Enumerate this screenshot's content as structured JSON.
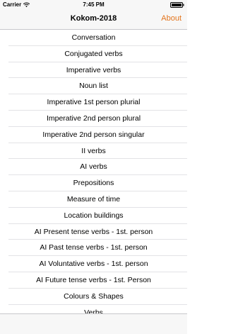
{
  "status_bar": {
    "carrier": "Carrier",
    "time": "7:45 PM"
  },
  "nav": {
    "title": "Kokom-2018",
    "about_label": "About"
  },
  "list": {
    "items": [
      "Conversation",
      "Conjugated verbs",
      "Imperative verbs",
      "Noun list",
      "Imperative 1st person plurial",
      "Imperative 2nd person plural",
      "Imperative 2nd person singular",
      "II verbs",
      "AI verbs",
      "Prepositions",
      "Measure of time",
      "Location buildings",
      "AI Present tense verbs - 1st. person",
      "AI Past tense verbs - 1st. person",
      "AI Voluntative verbs - 1st. person",
      "AI Future tense verbs - 1st. Person",
      "Colours & Shapes",
      "Verbs"
    ]
  },
  "colors": {
    "accent": "#e3741c",
    "bar_background": "#f7f7f7",
    "separator": "#e3e3e6"
  },
  "icons": {
    "wifi": "wifi-icon",
    "battery": "battery-icon"
  }
}
